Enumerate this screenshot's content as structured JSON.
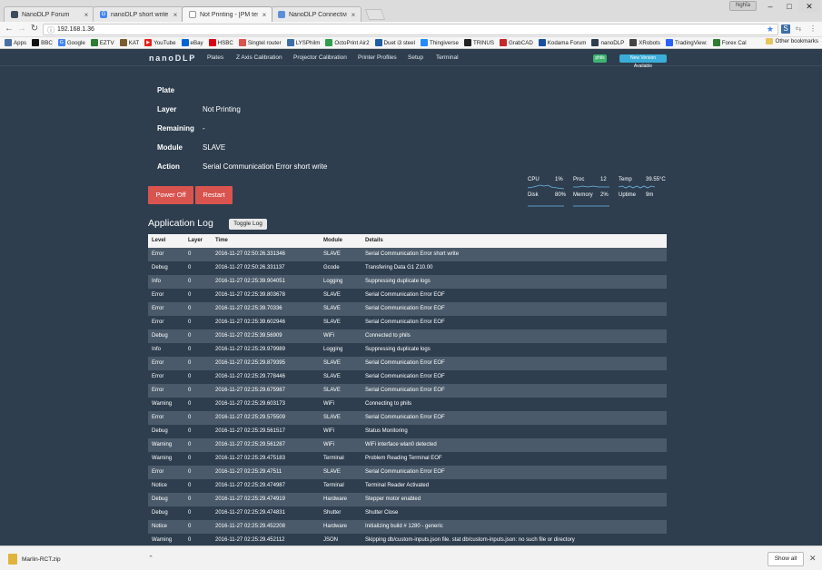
{
  "browser": {
    "tabs": [
      {
        "title": "NanoDLP Forum",
        "icon": "forum-favicon",
        "color": "#3d4b5a"
      },
      {
        "title": "nanoDLP short write - G",
        "icon": "google-favicon",
        "color": "#4285f4"
      },
      {
        "title": "Not Printing - [PM test ]",
        "icon": "page-favicon",
        "color": "#888888"
      },
      {
        "title": "NanoDLP Connectivity w",
        "icon": "chat-favicon",
        "color": "#5a8fd8"
      }
    ],
    "profile": "Nghĩa",
    "url": "192.168.1.36",
    "bookmarks": [
      {
        "label": "Apps",
        "color": "#4a6fa5"
      },
      {
        "label": "BBC",
        "color": "#111111"
      },
      {
        "label": "Google",
        "color": "#4285f4"
      },
      {
        "label": "EZTV",
        "color": "#2e7d32"
      },
      {
        "label": "KAT",
        "color": "#7a5c2e"
      },
      {
        "label": "YouTube",
        "color": "#e62117"
      },
      {
        "label": "eBay",
        "color": "#0064d2"
      },
      {
        "label": "HSBC",
        "color": "#db0011"
      },
      {
        "label": "Singtel router",
        "color": "#d9534f"
      },
      {
        "label": "LYSPhilm",
        "color": "#3b6ea5"
      },
      {
        "label": "OctoPrint Air2",
        "color": "#2e9e4f"
      },
      {
        "label": "Duet i3 steel",
        "color": "#1f5fa8"
      },
      {
        "label": "Thingiverse",
        "color": "#248bfb"
      },
      {
        "label": "TRINUS",
        "color": "#222222"
      },
      {
        "label": "GrabCAD",
        "color": "#c62828"
      },
      {
        "label": "Kodama Forum",
        "color": "#1a4fa0"
      },
      {
        "label": "nanoDLP",
        "color": "#2e3e4f"
      },
      {
        "label": "XRobots",
        "color": "#444444"
      },
      {
        "label": "TradingView:",
        "color": "#2962ff"
      },
      {
        "label": "Forex Cal",
        "color": "#2e7d32"
      }
    ],
    "other_bookmarks": "Other bookmarks",
    "download": {
      "filename": "Marlin-RCT.zip",
      "show_all": "Show all"
    }
  },
  "nav": {
    "logo": "nanoDLP",
    "links": [
      "Plates",
      "Z Axis Calibration",
      "Projector Calibration",
      "Printer Profiles",
      "Setup",
      "Terminal"
    ],
    "status_badge": "phils",
    "new_version": "New Version Available"
  },
  "status": {
    "plate_label": "Plate",
    "plate_value": "",
    "layer_label": "Layer",
    "layer_value": "Not Printing",
    "remaining_label": "Remaining",
    "remaining_value": "-",
    "module_label": "Module",
    "module_value": "SLAVE",
    "action_label": "Action",
    "action_value": "Serial Communication Error short write"
  },
  "actions": {
    "power_off": "Power Off",
    "restart": "Restart"
  },
  "stats": {
    "cpu_label": "CPU",
    "cpu_value": "1%",
    "proc_label": "Proc",
    "proc_value": "12",
    "temp_label": "Temp",
    "temp_value": "39.55°C",
    "disk_label": "Disk",
    "disk_value": "80%",
    "memory_label": "Memory",
    "memory_value": "2%",
    "uptime_label": "Uptime",
    "uptime_value": "9m"
  },
  "log": {
    "title": "Application Log",
    "toggle": "Toggle Log",
    "headers": [
      "Level",
      "Layer",
      "Time",
      "Module",
      "Details"
    ],
    "rows": [
      [
        "Error",
        "0",
        "2016-11-27 02:50:26.331346",
        "SLAVE",
        "Serial Communication Error short write"
      ],
      [
        "Debug",
        "0",
        "2016-11-27 02:50:26.331137",
        "Gcode",
        "Transfering Data G1 Z10.00"
      ],
      [
        "Info",
        "0",
        "2016-11-27 02:25:39.904051",
        "Logging",
        "Suppressing duplicate logs"
      ],
      [
        "Error",
        "0",
        "2016-11-27 02:25:39.803678",
        "SLAVE",
        "Serial Communication Error EOF"
      ],
      [
        "Error",
        "0",
        "2016-11-27 02:25:39.70336",
        "SLAVE",
        "Serial Communication Error EOF"
      ],
      [
        "Error",
        "0",
        "2016-11-27 02:25:39.602946",
        "SLAVE",
        "Serial Communication Error EOF"
      ],
      [
        "Debug",
        "0",
        "2016-11-27 02:25:39.56909",
        "WiFi",
        "Connected to phils"
      ],
      [
        "Info",
        "0",
        "2016-11-27 02:25:29.979989",
        "Logging",
        "Suppressing duplicate logs"
      ],
      [
        "Error",
        "0",
        "2016-11-27 02:25:29.879395",
        "SLAVE",
        "Serial Communication Error EOF"
      ],
      [
        "Error",
        "0",
        "2016-11-27 02:25:29.778446",
        "SLAVE",
        "Serial Communication Error EOF"
      ],
      [
        "Error",
        "0",
        "2016-11-27 02:25:29.675987",
        "SLAVE",
        "Serial Communication Error EOF"
      ],
      [
        "Warning",
        "0",
        "2016-11-27 02:25:29.603173",
        "WiFi",
        "Connecting to phils"
      ],
      [
        "Error",
        "0",
        "2016-11-27 02:25:29.575509",
        "SLAVE",
        "Serial Communication Error EOF"
      ],
      [
        "Debug",
        "0",
        "2016-11-27 02:25:29.561517",
        "WiFi",
        "Status Monitoring"
      ],
      [
        "Warning",
        "0",
        "2016-11-27 02:25:29.561287",
        "WiFi",
        "WiFi interface wlan0 detected"
      ],
      [
        "Warning",
        "0",
        "2016-11-27 02:25:29.475183",
        "Terminal",
        "Problem Reading Terminal EOF"
      ],
      [
        "Error",
        "0",
        "2016-11-27 02:25:29.47511",
        "SLAVE",
        "Serial Communication Error EOF"
      ],
      [
        "Notice",
        "0",
        "2016-11-27 02:25:29.474987",
        "Terminal",
        "Terminal Reader Activated"
      ],
      [
        "Debug",
        "0",
        "2016-11-27 02:25:29.474919",
        "Hardware",
        "Stepper motor enabled"
      ],
      [
        "Debug",
        "0",
        "2016-11-27 02:25:29.474831",
        "Shutter",
        "Shutter Close"
      ],
      [
        "Notice",
        "0",
        "2016-11-27 02:25:29.452208",
        "Hardware",
        "Initializing build # 1280 - generic"
      ],
      [
        "Warning",
        "0",
        "2016-11-27 02:25:29.452112",
        "JSON",
        "Skipping db/custom-inputs.json file. stat db/custom-inputs.json: no such file or directory"
      ]
    ]
  }
}
